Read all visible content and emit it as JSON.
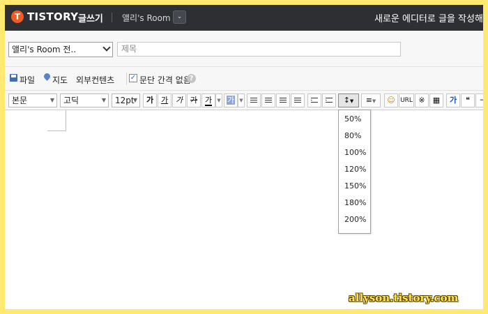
{
  "header": {
    "logo_mark": "T",
    "logo_text": "TISTORY",
    "write_label": "글쓰기",
    "blog_name": "앨리's Room",
    "right_text": "새로운 에디터로 글을 작성해"
  },
  "title_row": {
    "category_value": "앨리's Room 전..",
    "title_placeholder": "제목"
  },
  "attach_row": {
    "file_label": "파일",
    "map_label": "지도",
    "external_label": "외부컨텐츠",
    "paragraph_gap_label": "문단 간격 없음",
    "paragraph_gap_checked": true,
    "help_symbol": "?"
  },
  "toolbar": {
    "style_value": "본문",
    "font_value": "고딕",
    "size_value": "12pt",
    "bold_label": "가",
    "italic_label": "가",
    "underline_label": "가",
    "strike_label": "가",
    "font_color_label": "가",
    "highlight_label": "가",
    "url_label": "URL",
    "box_label": "가",
    "quote_label": "❝"
  },
  "line_height_menu": {
    "options": [
      "50%",
      "80%",
      "100%",
      "120%",
      "150%",
      "180%",
      "200%"
    ]
  },
  "watermark": "allyson.tistory.com",
  "colors": {
    "frame": "#ffe970",
    "topbar": "#2d2f33",
    "logo": "#f15a22",
    "panel": "#f7f7f7"
  }
}
